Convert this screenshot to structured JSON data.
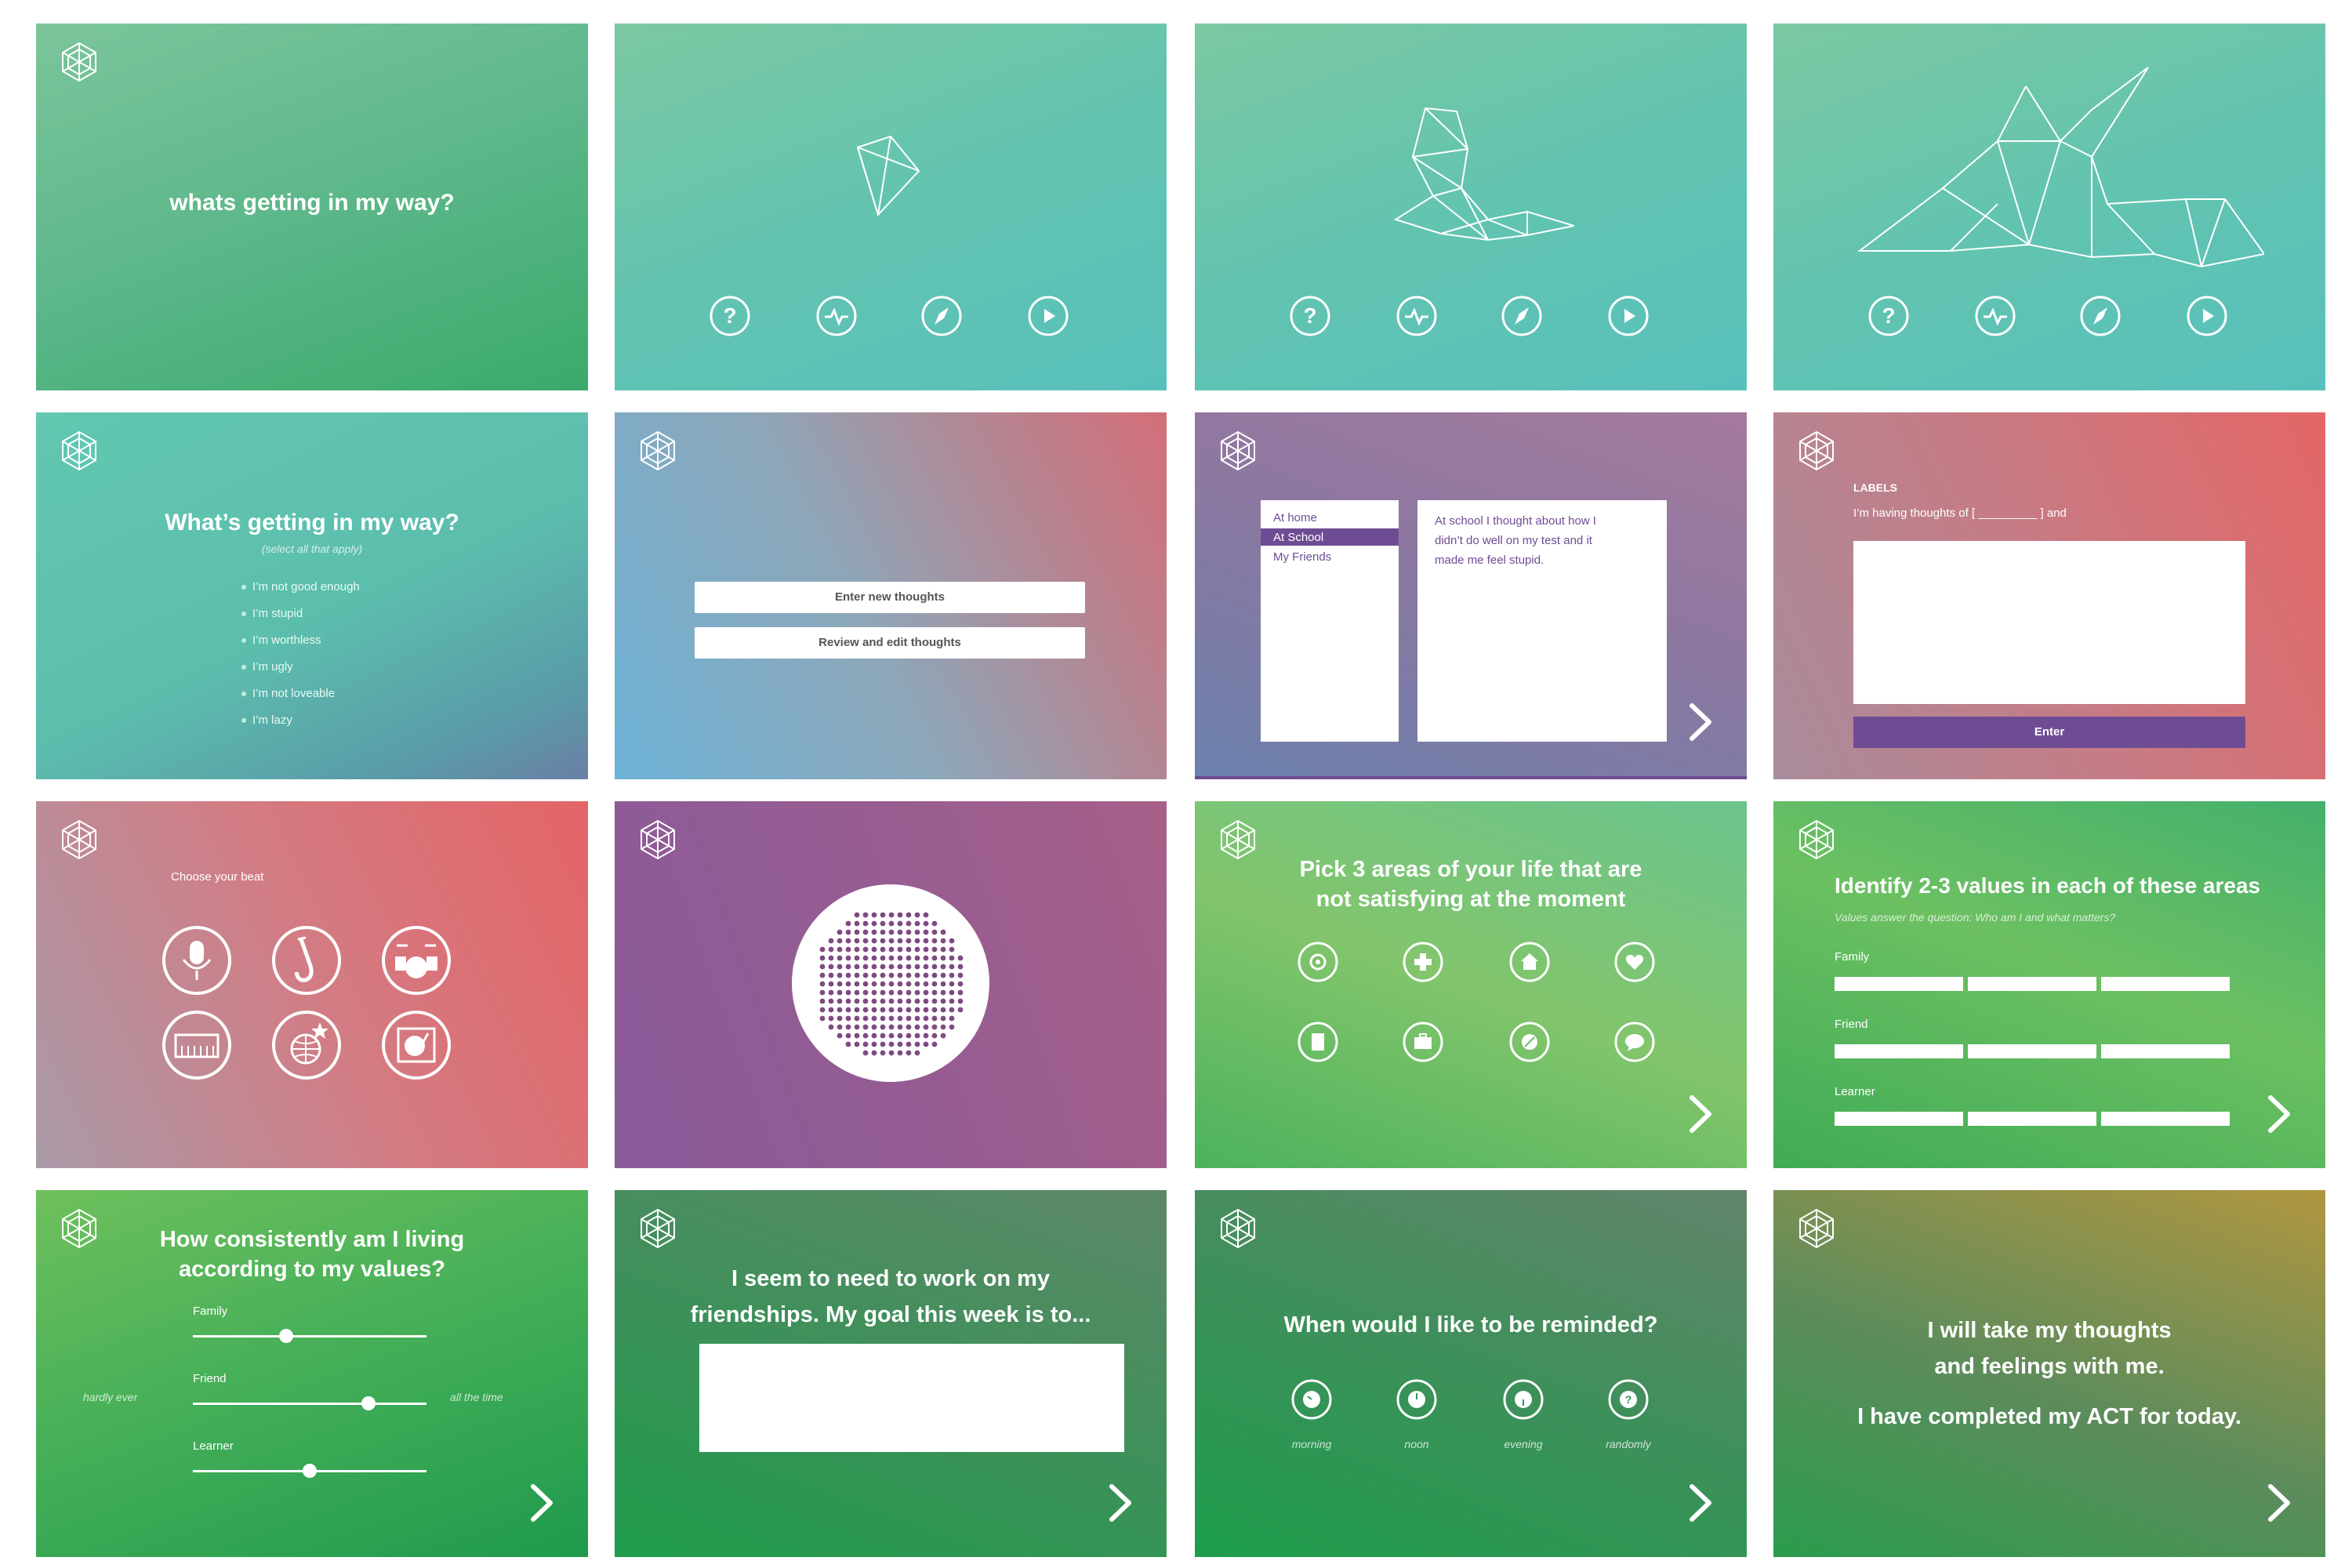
{
  "screens": {
    "s1": {
      "title": "whats getting in my way?"
    },
    "s2": {
      "nav_icons": [
        "question-icon",
        "pulse-chat-icon",
        "compass-icon",
        "play-icon"
      ]
    },
    "s5": {
      "title": "What’s getting in my way?",
      "subtitle": "(select all that apply)",
      "options": [
        "I’m not good enough",
        "I’m stupid",
        "I’m worthless",
        "I’m ugly",
        "I’m not loveable",
        "I’m lazy"
      ]
    },
    "s6": {
      "enter_new": "Enter new thoughts",
      "review_edit": "Review and edit thoughts"
    },
    "s7": {
      "locations": [
        "At home",
        "At School",
        "My Friends"
      ],
      "selected_location": "At School",
      "note": "At school I thought about how I didn’t do well on my test and it made me feel stupid."
    },
    "s8": {
      "section_label": "LABELS",
      "prompt": "I’m having thoughts of [ _________ ] and",
      "enter_label": "Enter"
    },
    "s9": {
      "title": "Choose your beat",
      "beat_icons": [
        "microphone-icon",
        "saxophone-icon",
        "drum-kit-icon",
        "keyboard-icon",
        "disco-ball-icon",
        "turntable-icon"
      ]
    },
    "s11": {
      "title_line1": "Pick 3 areas of your life that are",
      "title_line2": "not satisfying at the moment",
      "area_icons": [
        "target-icon",
        "plus-icon",
        "home-icon",
        "heart-icon",
        "book-icon",
        "briefcase-icon",
        "leaf-icon",
        "chat-icon"
      ]
    },
    "s12": {
      "title": "Identify 2-3 values in each of these areas",
      "subtitle": "Values answer the question: Who am I and what matters?",
      "areas": [
        "Family",
        "Friend",
        "Learner"
      ]
    },
    "s13": {
      "title_line1": "How consistently am I living",
      "title_line2": "according to my values?",
      "low_label": "hardly ever",
      "high_label": "all the time",
      "sliders": [
        {
          "label": "Family",
          "value": 0.4
        },
        {
          "label": "Friend",
          "value": 0.75
        },
        {
          "label": "Learner",
          "value": 0.5
        }
      ]
    },
    "s14": {
      "title_line1": "I seem to need to work on my",
      "title_line2": "friendships. My goal this week is to..."
    },
    "s15": {
      "title": "When would I like to be reminded?",
      "options": [
        "morning",
        "noon",
        "evening",
        "randomly"
      ]
    },
    "s16": {
      "line1": "I will take my thoughts",
      "line2": "and feelings with me.",
      "line3": "I have completed my ACT for today."
    }
  },
  "colors": {
    "purple_accent": "#6e4c94",
    "dot_purple": "#7e4a82"
  }
}
